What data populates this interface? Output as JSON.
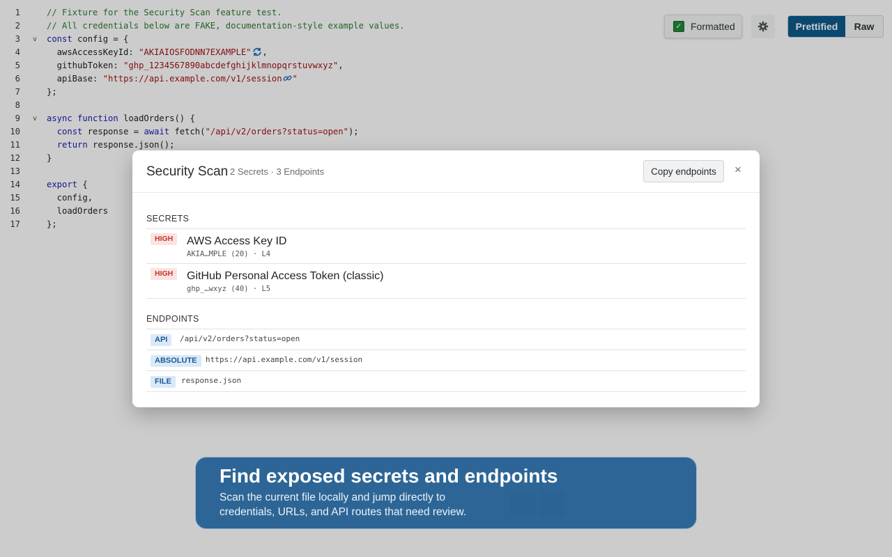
{
  "editor": {
    "lines": [
      {
        "n": "1",
        "fold": "",
        "parts": [
          {
            "c": "t-comment",
            "t": "// Fixture for the Security Scan feature test."
          }
        ]
      },
      {
        "n": "2",
        "fold": "",
        "parts": [
          {
            "c": "t-comment",
            "t": "// All credentials below are FAKE, documentation-style example values."
          }
        ]
      },
      {
        "n": "3",
        "fold": "v",
        "parts": [
          {
            "c": "t-kw",
            "t": "const"
          },
          {
            "c": "t-plain",
            "t": " config = {"
          }
        ]
      },
      {
        "n": "4",
        "fold": "",
        "parts": [
          {
            "c": "t-plain",
            "t": "  awsAccessKeyId: "
          },
          {
            "c": "t-str",
            "t": "\"AKIAIOSFODNN7EXAMPLE\""
          },
          {
            "icon": "refresh-icon"
          },
          {
            "c": "t-plain",
            "t": ","
          }
        ]
      },
      {
        "n": "5",
        "fold": "",
        "parts": [
          {
            "c": "t-plain",
            "t": "  githubToken: "
          },
          {
            "c": "t-str",
            "t": "\"ghp_1234567890abcdefghijklmnopqrstuvwxyz\""
          },
          {
            "c": "t-plain",
            "t": ","
          }
        ]
      },
      {
        "n": "6",
        "fold": "",
        "parts": [
          {
            "c": "t-plain",
            "t": "  apiBase: "
          },
          {
            "c": "t-str",
            "t": "\"https://api.example.com/v1/session"
          },
          {
            "icon": "link-icon"
          },
          {
            "c": "t-str",
            "t": "\""
          }
        ]
      },
      {
        "n": "7",
        "fold": "",
        "parts": [
          {
            "c": "t-plain",
            "t": "};"
          }
        ]
      },
      {
        "n": "8",
        "fold": "",
        "parts": []
      },
      {
        "n": "9",
        "fold": "v",
        "parts": [
          {
            "c": "t-kw",
            "t": "async function"
          },
          {
            "c": "t-plain",
            "t": " loadOrders() {"
          }
        ]
      },
      {
        "n": "10",
        "fold": "",
        "parts": [
          {
            "c": "t-plain",
            "t": "  "
          },
          {
            "c": "t-kw",
            "t": "const"
          },
          {
            "c": "t-plain",
            "t": " response = "
          },
          {
            "c": "t-kw",
            "t": "await"
          },
          {
            "c": "t-plain",
            "t": " fetch("
          },
          {
            "c": "t-str",
            "t": "\"/api/v2/orders?status=open\""
          },
          {
            "c": "t-plain",
            "t": ");"
          }
        ]
      },
      {
        "n": "11",
        "fold": "",
        "parts": [
          {
            "c": "t-plain",
            "t": "  "
          },
          {
            "c": "t-kw",
            "t": "return"
          },
          {
            "c": "t-plain",
            "t": " response.json();"
          }
        ]
      },
      {
        "n": "12",
        "fold": "",
        "parts": [
          {
            "c": "t-plain",
            "t": "}"
          }
        ]
      },
      {
        "n": "13",
        "fold": "",
        "parts": []
      },
      {
        "n": "14",
        "fold": "",
        "parts": [
          {
            "c": "t-kw",
            "t": "export"
          },
          {
            "c": "t-plain",
            "t": " {"
          }
        ]
      },
      {
        "n": "15",
        "fold": "",
        "parts": [
          {
            "c": "t-plain",
            "t": "  config,"
          }
        ]
      },
      {
        "n": "16",
        "fold": "",
        "parts": [
          {
            "c": "t-plain",
            "t": "  loadOrders"
          }
        ]
      },
      {
        "n": "17",
        "fold": "",
        "parts": [
          {
            "c": "t-plain",
            "t": "};"
          }
        ]
      }
    ]
  },
  "toolbar": {
    "formatted_label": "Formatted",
    "formatted_checked": true,
    "check_mark": "✓",
    "gear_icon": "gear-icon",
    "view_modes": [
      "Prettified",
      "Raw"
    ],
    "active_mode": "Prettified"
  },
  "modal": {
    "title": "Security Scan",
    "summary": "2 Secrets · 3 Endpoints",
    "copy_label": "Copy endpoints",
    "close_label": "×",
    "secrets_heading": "SECRETS",
    "secrets": [
      {
        "severity": "HIGH",
        "name": "AWS Access Key ID",
        "meta": "AKIA…MPLE (20) · L4"
      },
      {
        "severity": "HIGH",
        "name": "GitHub Personal Access Token (classic)",
        "meta": "ghp_…wxyz (40) · L5"
      }
    ],
    "endpoints_heading": "ENDPOINTS",
    "endpoints": [
      {
        "kind": "API",
        "path": "/api/v2/orders?status=open"
      },
      {
        "kind": "ABSOLUTE",
        "path": "https://api.example.com/v1/session"
      },
      {
        "kind": "FILE",
        "path": "response.json"
      }
    ]
  },
  "banner": {
    "title": "Find exposed secrets and endpoints",
    "text": "Scan the current file locally and jump directly to credentials, URLs, and API routes that need review."
  },
  "colors": {
    "accent": "#0d5a8c",
    "high_badge_bg": "#fbe3e3",
    "high_badge_fg": "#c0392b",
    "endpoint_badge_bg": "#dbe9f7",
    "endpoint_badge_fg": "#1a5a96",
    "banner_bg": "#11548c"
  }
}
